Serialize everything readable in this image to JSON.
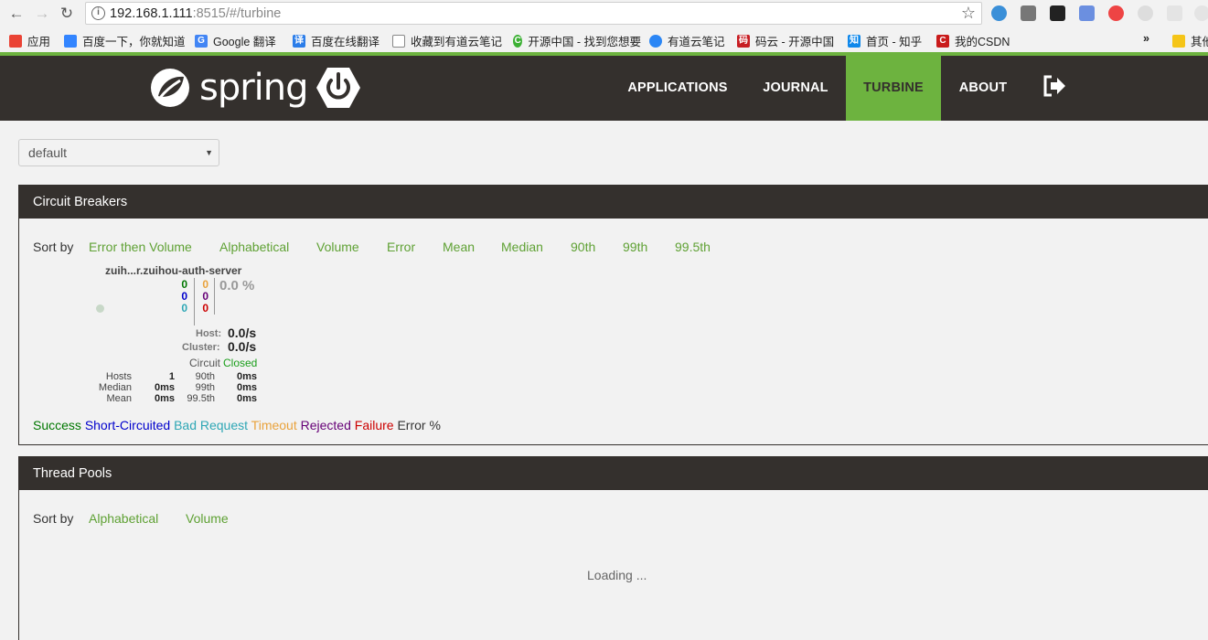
{
  "browser": {
    "url_host": "192.168.1.111",
    "url_rest": ":8515/#/turbine",
    "bookmarks": [
      {
        "label": "应用",
        "color": "#ea4335"
      },
      {
        "label": "百度一下，你就知道",
        "color": "#3385ff"
      },
      {
        "label": "Google 翻译",
        "color": "#4285f4"
      },
      {
        "label": "百度在线翻译",
        "color": "#2b7de9"
      },
      {
        "label": "收藏到有道云笔记",
        "color": "#ffffff"
      },
      {
        "label": "开源中国 - 找到您想要",
        "color": "#3cb034"
      },
      {
        "label": "有道云笔记",
        "color": "#2b86f5"
      },
      {
        "label": "码云 - 开源中国",
        "color": "#c71d23"
      },
      {
        "label": "首页 - 知乎",
        "color": "#0f88eb"
      },
      {
        "label": "我的CSDN",
        "color": "#c91b1b"
      }
    ],
    "more": "»",
    "other_bookmarks": "其他"
  },
  "header": {
    "logo_text": "spring",
    "nav": [
      {
        "label": "APPLICATIONS"
      },
      {
        "label": "JOURNAL"
      },
      {
        "label": "TURBINE",
        "active": true
      },
      {
        "label": "ABOUT"
      }
    ]
  },
  "cluster_select": {
    "value": "default"
  },
  "circuit_breakers": {
    "title": "Circuit Breakers",
    "sort_label": "Sort by",
    "sort_options": [
      "Error then Volume",
      "Alphabetical",
      "Volume",
      "Error",
      "Mean",
      "Median",
      "90th",
      "99th",
      "99.5th"
    ],
    "circuit": {
      "name": "zuih...r.zuihou-auth-server",
      "counts_left": [
        "0",
        "0",
        "0"
      ],
      "counts_right": [
        "0",
        "0",
        "0"
      ],
      "error_rate": "0.0 %",
      "host_label": "Host:",
      "host_rate": "0.0/s",
      "cluster_label": "Cluster:",
      "cluster_rate": "0.0/s",
      "circuit_label": "Circuit",
      "circuit_status": "Closed",
      "stats": {
        "hosts_label": "Hosts",
        "hosts_value": "1",
        "median_label": "Median",
        "median_value": "0ms",
        "mean_label": "Mean",
        "mean_value": "0ms",
        "p90_label": "90th",
        "p90_value": "0ms",
        "p99_label": "99th",
        "p99_value": "0ms",
        "p995_label": "99.5th",
        "p995_value": "0ms"
      }
    },
    "legend": [
      {
        "label": "Success",
        "color": "#007700"
      },
      {
        "label": "Short-Circuited",
        "color": "#0000cc"
      },
      {
        "label": "Bad Request",
        "color": "#2ea7b5"
      },
      {
        "label": "Timeout",
        "color": "#e9a23b"
      },
      {
        "label": "Rejected",
        "color": "#660077"
      },
      {
        "label": "Failure",
        "color": "#cc0000"
      },
      {
        "label": "Error %",
        "color": "#333333"
      }
    ]
  },
  "thread_pools": {
    "title": "Thread Pools",
    "sort_label": "Sort by",
    "sort_options": [
      "Alphabetical",
      "Volume"
    ],
    "loading": "Loading ..."
  },
  "colors": {
    "brand_green": "#6db33f",
    "header_dark": "#34302d"
  }
}
